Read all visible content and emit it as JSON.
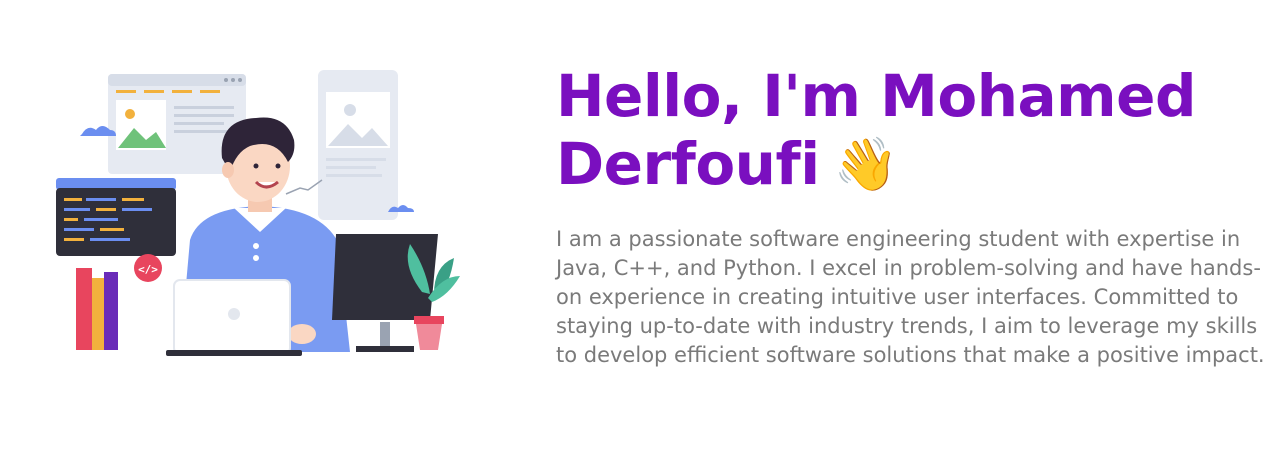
{
  "hero": {
    "title_line1": "Hello, I'm Mohamed",
    "title_line2": "Derfoufi",
    "wave_emoji": "👋",
    "description": "I am a passionate software engineering student with expertise in Java, C++, and Python. I excel in problem-solving and have hands-on experience in creating intuitive user interfaces. Committed to staying up-to-date with industry trends, I aim to leverage my skills to develop efficient software solutions that make a positive impact."
  },
  "illustration": {
    "icon": "developer-at-laptop-illustration",
    "code_badge": "</>"
  },
  "colors": {
    "title": "#7a0fbf",
    "body_text": "#7a7a7a",
    "accent_blue": "#6b8ef0",
    "accent_pink": "#e8455e"
  }
}
